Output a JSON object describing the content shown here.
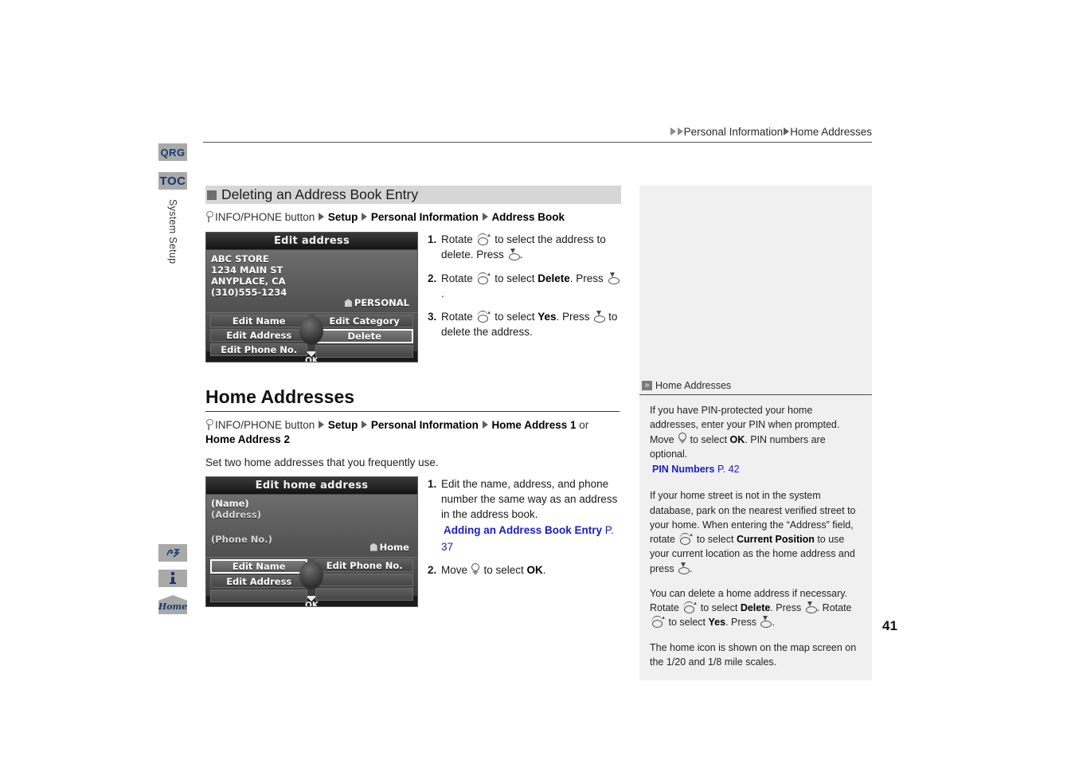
{
  "header": {
    "breadcrumb_parts": [
      "Personal Information",
      "Home Addresses"
    ],
    "breadcrumb_text": "Personal Information Home Addresses"
  },
  "side_tabs": {
    "qrg": "QRG",
    "toc": "TOC",
    "chapter": "System Setup"
  },
  "side_icons": [
    {
      "name": "voice-command-icon",
      "label": ""
    },
    {
      "name": "info-icon",
      "label": "i"
    },
    {
      "name": "home-icon",
      "label": "Home"
    }
  ],
  "section1": {
    "title": "Deleting an Address Book Entry",
    "path": {
      "button": "INFO/PHONE button",
      "items": [
        "Setup",
        "Personal Information",
        "Address Book"
      ]
    },
    "screenshot": {
      "title": "Edit address",
      "lines": [
        "ABC STORE",
        "1234 MAIN ST",
        "ANYPLACE, CA",
        "(310)555-1234"
      ],
      "category": "PERSONAL",
      "buttons_left": [
        "Edit Name",
        "Edit Address",
        "Edit Phone No."
      ],
      "buttons_right": [
        "Edit Category",
        "Delete",
        ""
      ],
      "selected": "Delete",
      "footer": "OK"
    },
    "steps": [
      {
        "num": "1.",
        "pre": "Rotate ",
        "mid": " to select the address to delete. Press ",
        "post": "."
      },
      {
        "num": "2.",
        "pre": "Rotate ",
        "mid": " to select ",
        "bold": "Delete",
        "tail": ". Press ",
        "post": "."
      },
      {
        "num": "3.",
        "pre": "Rotate ",
        "mid": " to select ",
        "bold": "Yes",
        "tail": ". Press ",
        "post": " to delete the address."
      }
    ]
  },
  "section2": {
    "title": "Home Addresses",
    "path": {
      "button": "INFO/PHONE button",
      "items": [
        "Setup",
        "Personal Information",
        "Home Address 1"
      ],
      "or": "or",
      "last": "Home Address 2"
    },
    "lead": "Set two home addresses that you frequently use.",
    "screenshot": {
      "title": "Edit home address",
      "lines": [
        "(Name)",
        "(Address)",
        "(Phone No.)"
      ],
      "category": "Home",
      "buttons_left": [
        "Edit Name",
        "Edit Address",
        ""
      ],
      "buttons_right": [
        "Edit Phone No.",
        "",
        ""
      ],
      "selected": "Edit Name",
      "footer": "OK"
    },
    "steps": [
      {
        "num": "1.",
        "text": "Edit the name, address, and phone number the same way as an address in the address book.",
        "xref": "Adding an Address Book Entry",
        "xref_page": "P. 37"
      },
      {
        "num": "2.",
        "pre": "Move ",
        "mid": " to select ",
        "bold": "OK",
        "post": "."
      }
    ]
  },
  "rail": {
    "heading": "Home Addresses",
    "paragraphs": [
      {
        "id": "p1",
        "pre": "If you have PIN-protected your home addresses, enter your PIN when prompted. Move ",
        "mid": " to select ",
        "bold": "OK",
        "post": ". PIN numbers are optional.",
        "xref": "PIN Numbers",
        "xref_page": "P. 42"
      },
      {
        "id": "p2",
        "a": "If your home street is not in the system database, park on the nearest verified street to your home. When entering the “Address” field, rotate ",
        "b": " to select ",
        "bold": "Current Position",
        "c": " to use your current location as the home address and press ",
        "d": "."
      },
      {
        "id": "p3",
        "a": "You can delete a home address if necessary. Rotate ",
        "b": " to select ",
        "bold1": "Delete",
        "c": ". Press ",
        "d": ". Rotate ",
        "e": " to select ",
        "bold2": "Yes",
        "f": ". Press ",
        "g": "."
      },
      {
        "id": "p4",
        "text": "The home icon is shown on the map screen on the 1/20 and 1/8 mile scales."
      }
    ]
  },
  "page_number": "41",
  "colors": {
    "link": "#1a1ad0",
    "tab_gray": "#a9a9a9",
    "section_bar": "#d6d6d6",
    "rail_bg": "#f0f0f0",
    "tab_text": "#1a3a6b"
  }
}
